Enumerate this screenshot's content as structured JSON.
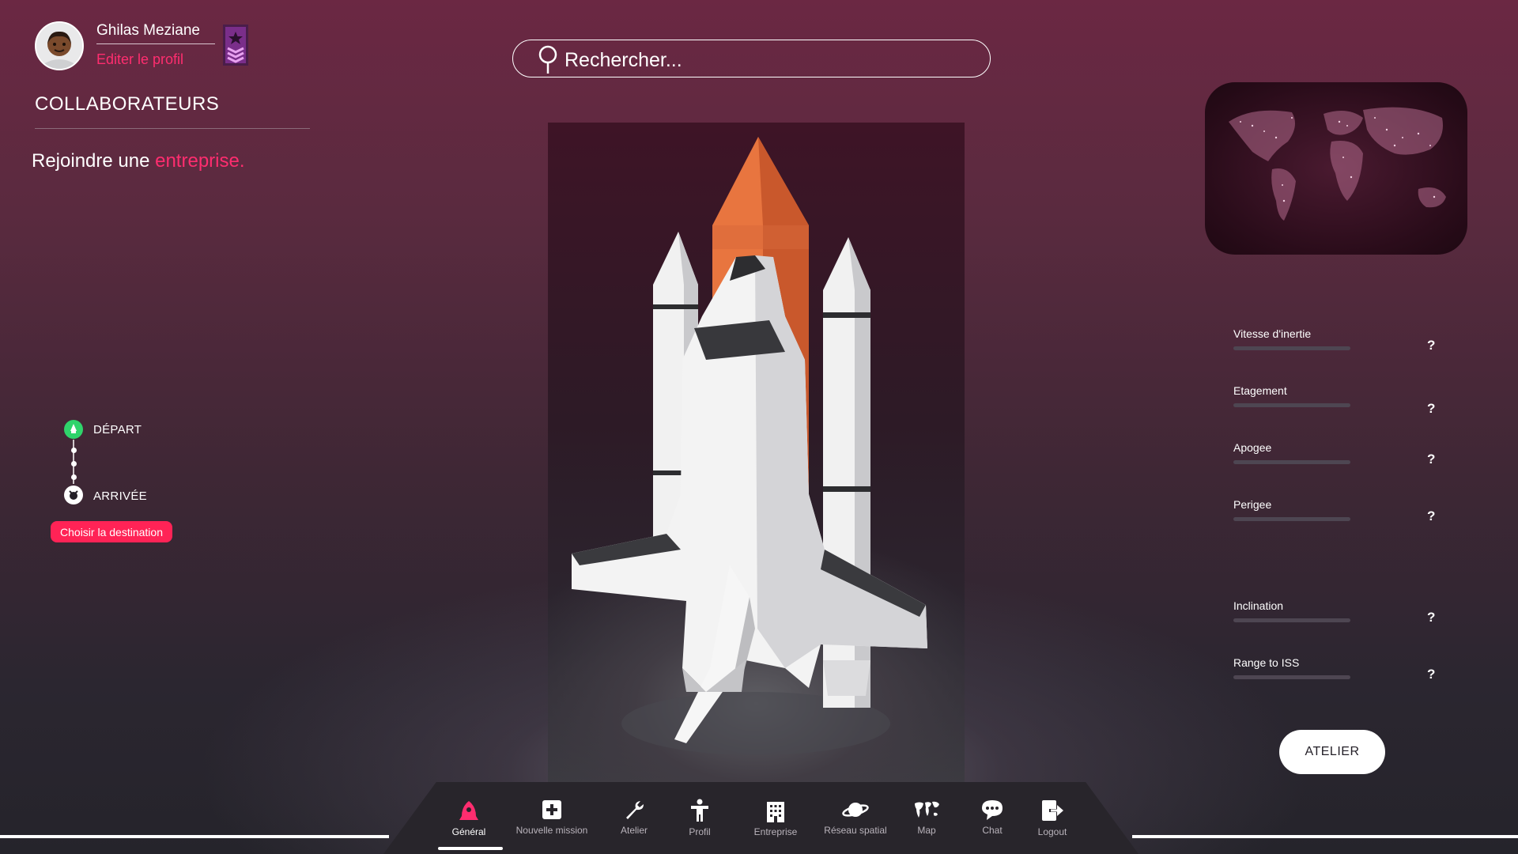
{
  "profile": {
    "name": "Ghilas Meziane",
    "edit_label": "Editer le profil"
  },
  "sidebar": {
    "title": "COLLABORATEURS",
    "join_prefix": "Rejoindre une ",
    "join_link": "entreprise."
  },
  "search": {
    "placeholder": "Rechercher..."
  },
  "trajectory": {
    "start_label": "DÉPART",
    "end_label": "ARRIVÉE",
    "choose_button": "Choisir la destination"
  },
  "stats": [
    {
      "label": "Vitesse d'inertie",
      "help": "?"
    },
    {
      "label": "Etagement",
      "help": "?"
    },
    {
      "label": "Apogee",
      "help": "?"
    },
    {
      "label": "Perigee",
      "help": "?"
    },
    {
      "label": "Inclination",
      "help": "?"
    },
    {
      "label": "Range to ISS",
      "help": "?"
    }
  ],
  "atelier_button": "ATELIER",
  "nav": [
    {
      "label": "Général",
      "icon": "rocket-icon",
      "active": true
    },
    {
      "label": "Nouvelle mission",
      "icon": "plus-square-icon"
    },
    {
      "label": "Atelier",
      "icon": "wrench-icon"
    },
    {
      "label": "Profil",
      "icon": "person-icon"
    },
    {
      "label": "Entreprise",
      "icon": "building-icon"
    },
    {
      "label": "Réseau spatial",
      "icon": "planet-icon"
    },
    {
      "label": "Map",
      "icon": "world-map-icon"
    },
    {
      "label": "Chat",
      "icon": "chat-bubble-icon"
    },
    {
      "label": "Logout",
      "icon": "logout-icon"
    }
  ],
  "colors": {
    "accent": "#ff2d6f",
    "button": "#ff2356",
    "start_dot": "#2fd46b",
    "nav_bg": "#28252b"
  }
}
